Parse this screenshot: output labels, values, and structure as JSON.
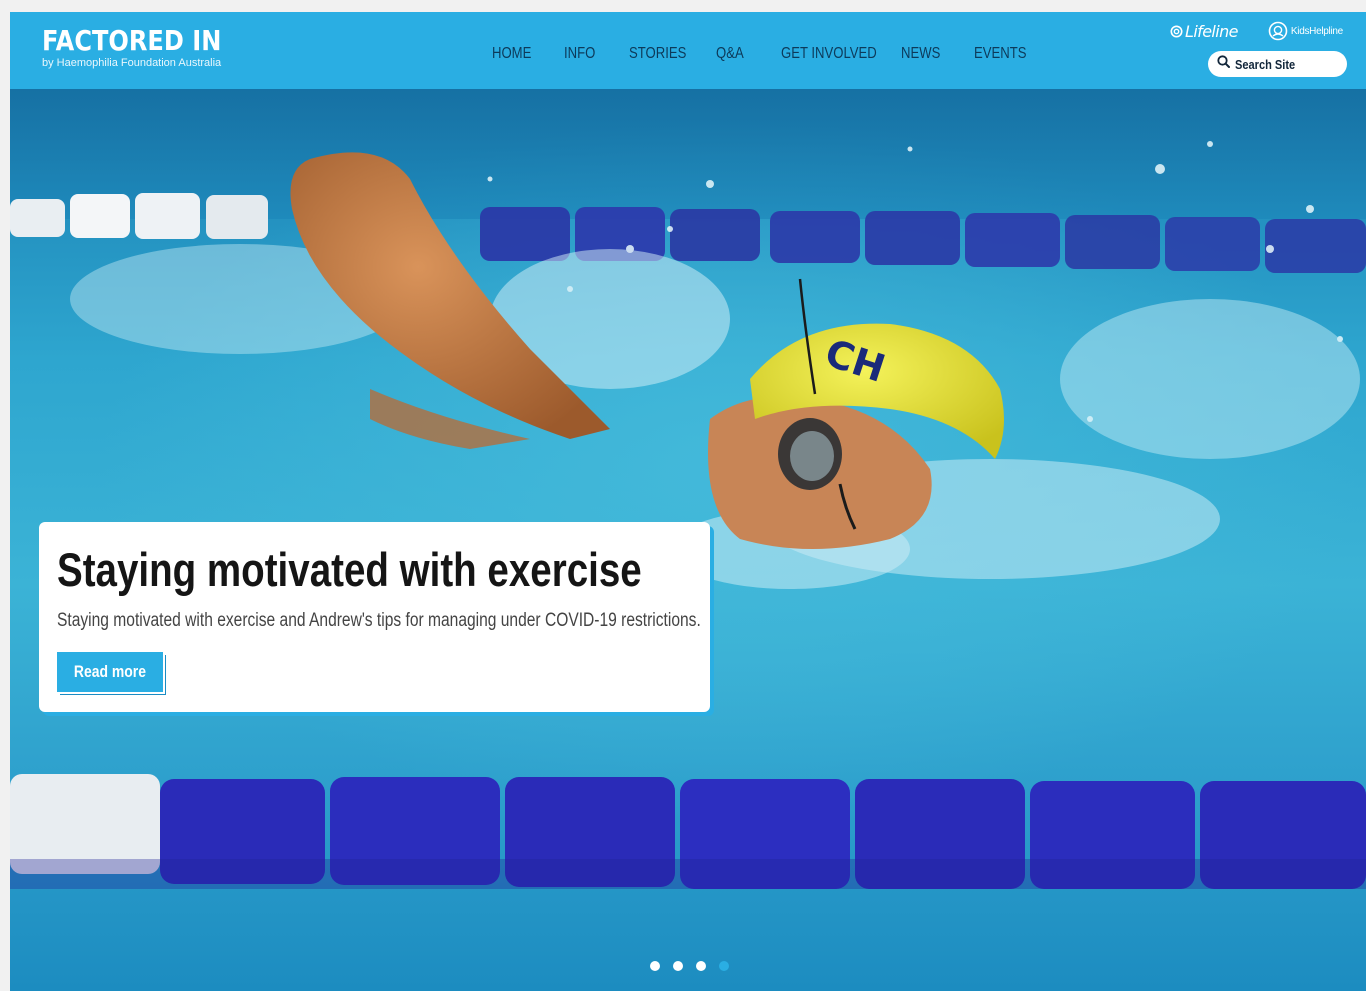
{
  "header": {
    "logo_title": "FACTORED IN",
    "logo_subtitle": "by Haemophilia Foundation Australia",
    "nav": [
      {
        "label": "HOME"
      },
      {
        "label": "INFO"
      },
      {
        "label": "STORIES"
      },
      {
        "label": "Q&A"
      },
      {
        "label": "GET INVOLVED"
      },
      {
        "label": "NEWS"
      },
      {
        "label": "EVENTS"
      }
    ],
    "partners": {
      "lifeline": "Lifeline",
      "kidshelpline": "KidsHelpline"
    },
    "search": {
      "label": "Search Site"
    }
  },
  "hero": {
    "title": "Staying motivated with exercise",
    "description": "Staying motivated with exercise and Andrew's tips for managing under COVID-19 restrictions.",
    "button_label": "Read more",
    "image": "swimmer-freestyle-photo",
    "cap_text": "CH",
    "slides": {
      "count": 4,
      "active_index": 4
    }
  },
  "colors": {
    "brand_blue": "#2aaee3",
    "nav_text": "#0d3a5a",
    "title_text": "#151515",
    "body_text": "#444444"
  }
}
